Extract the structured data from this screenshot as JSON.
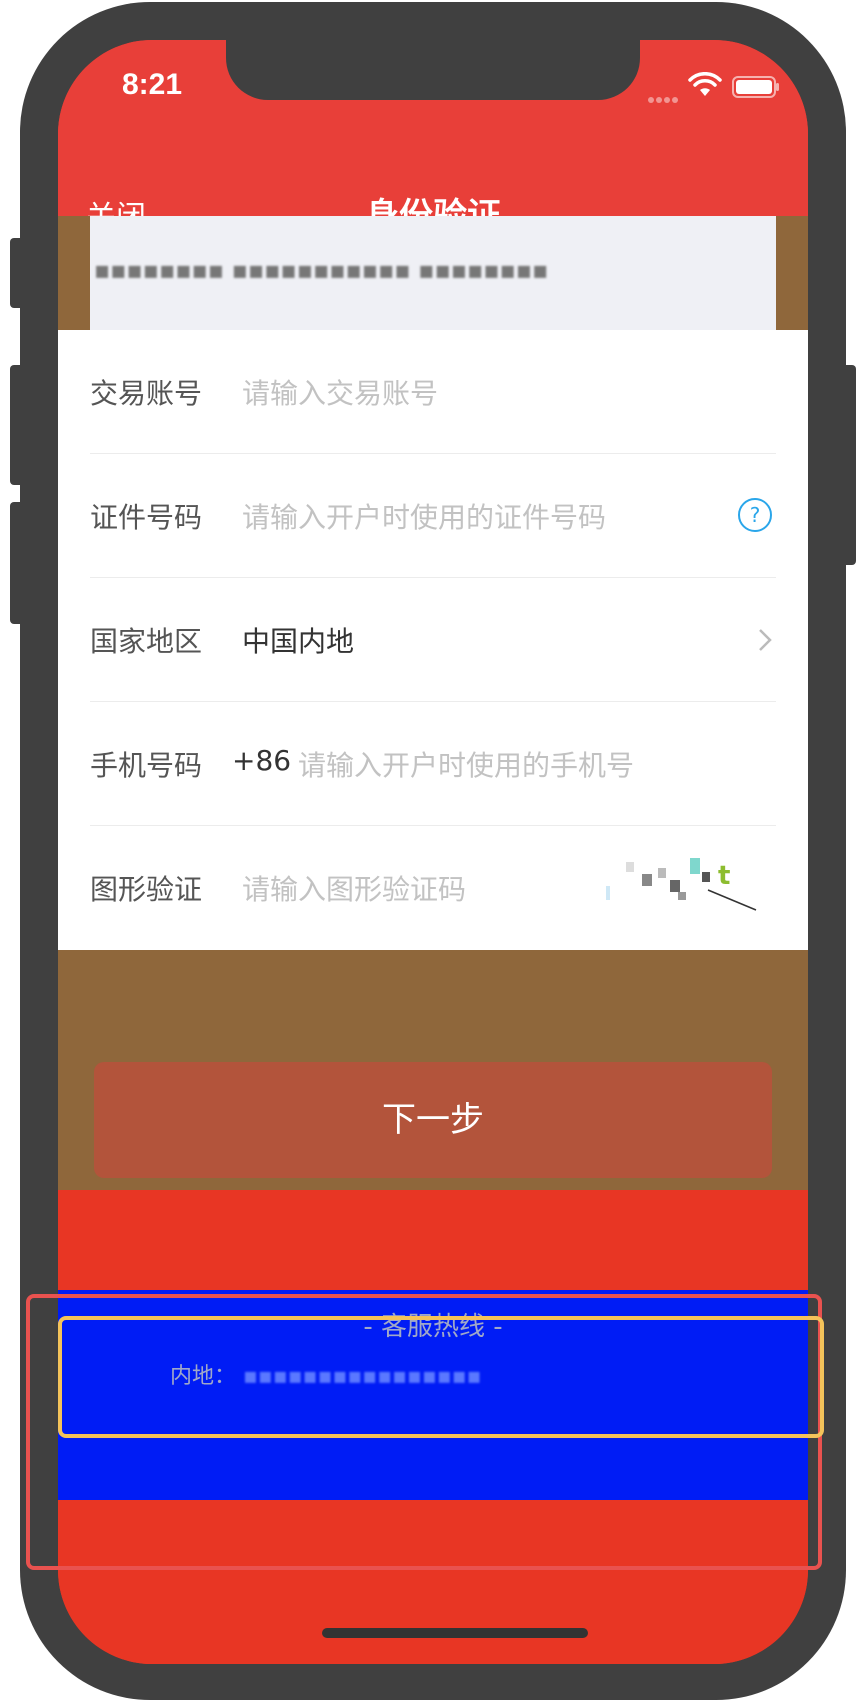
{
  "status_bar": {
    "time": "8:21",
    "icons": [
      "signal-dots-icon",
      "wifi-icon",
      "battery-icon"
    ]
  },
  "nav": {
    "close_label": "关闭",
    "title": "身份验证"
  },
  "notice": {
    "text": "▪▪▪▪▪▪▪▪ ▪▪▪▪▪▪▪▪▪▪▪ ▪▪▪▪▪▪▪▪"
  },
  "form": {
    "rows": [
      {
        "label": "交易账号",
        "placeholder": "请输入交易账号"
      },
      {
        "label": "证件号码",
        "placeholder": "请输入开户时使用的证件号码",
        "icon": "help-circle-icon"
      },
      {
        "label": "国家地区",
        "value": "中国内地",
        "icon": "chevron-right-icon"
      },
      {
        "label": "手机号码",
        "prefix": "+86",
        "placeholder": "请输入开户时使用的手机号"
      },
      {
        "label": "图形验证",
        "placeholder": "请输入图形验证码",
        "captcha_icon": "captcha-image"
      }
    ]
  },
  "next_button": {
    "label": "下一步"
  },
  "hotline": {
    "title": "- 客服热线 -",
    "mainland_label": "内地：",
    "mainland_value": "▪▪▪▪▪▪▪▪▪▪▪▪▪▪▪▪"
  },
  "colors": {
    "brand_red": "#e83f39",
    "button": "#b3543b",
    "blue_band": "#001cf5",
    "highlight_red": "#e9524f",
    "highlight_yellow": "#f4c35a"
  }
}
